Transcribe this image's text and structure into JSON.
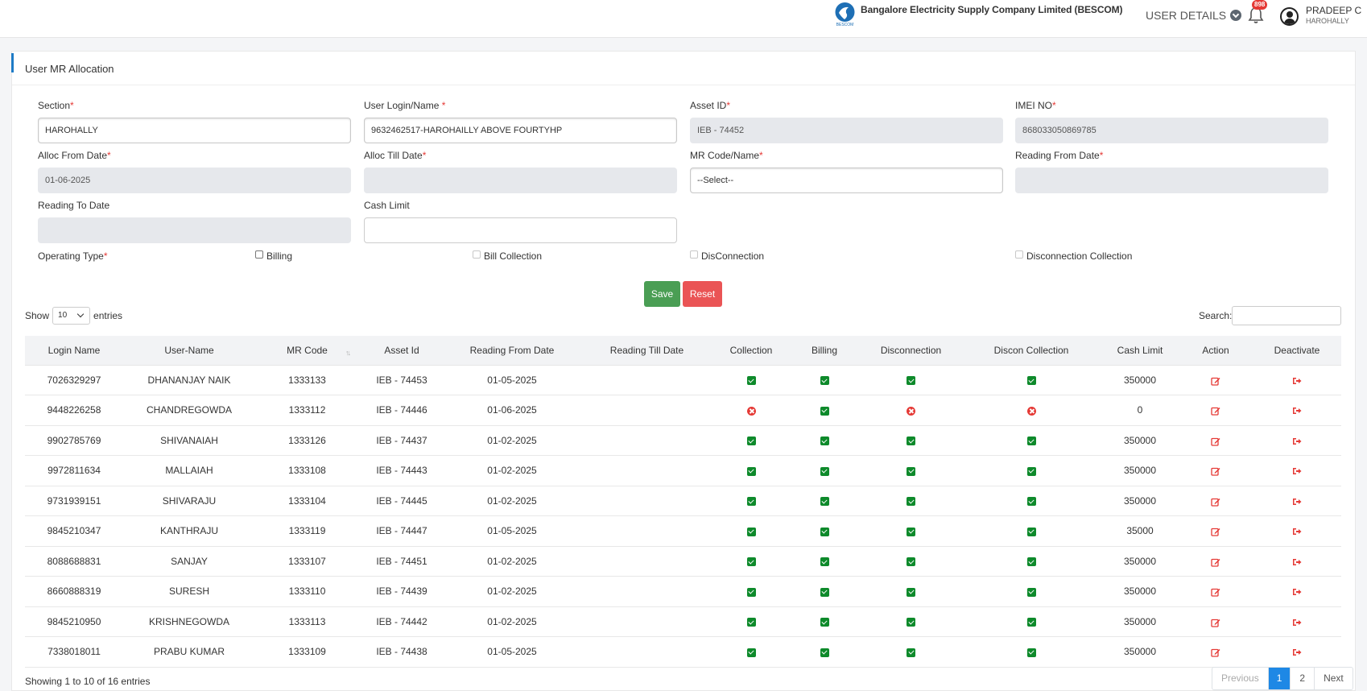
{
  "header": {
    "company": "Bangalore Electricity Supply Company Limited (BESCOM)",
    "user_details_label": "USER DETAILS",
    "notification_count": "898",
    "user_name": "PRADEEP C",
    "user_section": "HAROHALLY"
  },
  "page": {
    "title": "User MR Allocation"
  },
  "form": {
    "section_label": "Section",
    "section_value": "HAROHALLY",
    "user_login_label": "User Login/Name ",
    "user_login_value": "9632462517-HAROHAILLY ABOVE FOURTYHP",
    "asset_id_label": "Asset ID",
    "asset_id_value": "IEB - 74452",
    "imei_label": "IMEI NO",
    "imei_value": "868033050869785",
    "alloc_from_label": "Alloc From Date",
    "alloc_from_value": "01-06-2025",
    "alloc_till_label": "Alloc Till Date",
    "alloc_till_value": "",
    "mr_code_label": "MR Code/Name",
    "mr_code_value": "--Select--",
    "reading_from_label": "Reading From Date",
    "reading_from_value": "",
    "reading_to_label": "Reading To Date",
    "reading_to_value": "",
    "cash_limit_label": "Cash Limit",
    "cash_limit_value": "",
    "operating_type_label": "Operating Type",
    "op_billing": "Billing",
    "op_bill_collection": "Bill Collection",
    "op_disconnection": "DisConnection",
    "op_disconnection_collection": "Disconnection Collection",
    "required_mark": "*",
    "save_label": "Save",
    "reset_label": "Reset"
  },
  "table_controls": {
    "show_label": "Show",
    "page_length": "10",
    "entries_label": "entries",
    "search_label": "Search:"
  },
  "table": {
    "columns": [
      "Login Name",
      "User-Name",
      "MR Code",
      "Asset Id",
      "Reading From Date",
      "Reading Till Date",
      "Collection",
      "Billing",
      "Disconnection",
      "Discon Collection",
      "Cash Limit",
      "Action",
      "Deactivate"
    ],
    "rows": [
      {
        "login": "7026329297",
        "user": "DHANANJAY NAIK",
        "mr": "1333133",
        "asset": "IEB - 74453",
        "from": "01-05-2025",
        "till": "",
        "collection": true,
        "billing": true,
        "disconnection": true,
        "discon_collection": true,
        "cash": "350000"
      },
      {
        "login": "9448226258",
        "user": "CHANDREGOWDA",
        "mr": "1333112",
        "asset": "IEB - 74446",
        "from": "01-06-2025",
        "till": "",
        "collection": false,
        "billing": true,
        "disconnection": false,
        "discon_collection": false,
        "cash": "0"
      },
      {
        "login": "9902785769",
        "user": "SHIVANAIAH",
        "mr": "1333126",
        "asset": "IEB - 74437",
        "from": "01-02-2025",
        "till": "",
        "collection": true,
        "billing": true,
        "disconnection": true,
        "discon_collection": true,
        "cash": "350000"
      },
      {
        "login": "9972811634",
        "user": "MALLAIAH",
        "mr": "1333108",
        "asset": "IEB - 74443",
        "from": "01-02-2025",
        "till": "",
        "collection": true,
        "billing": true,
        "disconnection": true,
        "discon_collection": true,
        "cash": "350000"
      },
      {
        "login": "9731939151",
        "user": "SHIVARAJU",
        "mr": "1333104",
        "asset": "IEB - 74445",
        "from": "01-02-2025",
        "till": "",
        "collection": true,
        "billing": true,
        "disconnection": true,
        "discon_collection": true,
        "cash": "350000"
      },
      {
        "login": "9845210347",
        "user": "KANTHRAJU",
        "mr": "1333119",
        "asset": "IEB - 74447",
        "from": "01-05-2025",
        "till": "",
        "collection": true,
        "billing": true,
        "disconnection": true,
        "discon_collection": true,
        "cash": "35000"
      },
      {
        "login": "8088688831",
        "user": "SANJAY",
        "mr": "1333107",
        "asset": "IEB - 74451",
        "from": "01-02-2025",
        "till": "",
        "collection": true,
        "billing": true,
        "disconnection": true,
        "discon_collection": true,
        "cash": "350000"
      },
      {
        "login": "8660888319",
        "user": "SURESH",
        "mr": "1333110",
        "asset": "IEB - 74439",
        "from": "01-02-2025",
        "till": "",
        "collection": true,
        "billing": true,
        "disconnection": true,
        "discon_collection": true,
        "cash": "350000"
      },
      {
        "login": "9845210950",
        "user": "KRISHNEGOWDA",
        "mr": "1333113",
        "asset": "IEB - 74442",
        "from": "01-02-2025",
        "till": "",
        "collection": true,
        "billing": true,
        "disconnection": true,
        "discon_collection": true,
        "cash": "350000"
      },
      {
        "login": "7338018011",
        "user": "PRABU KUMAR",
        "mr": "1333109",
        "asset": "IEB - 74438",
        "from": "01-05-2025",
        "till": "",
        "collection": true,
        "billing": true,
        "disconnection": true,
        "discon_collection": true,
        "cash": "350000"
      }
    ]
  },
  "footer": {
    "info": "Showing 1 to 10 of 16 entries",
    "previous": "Previous",
    "pages": [
      "1",
      "2"
    ],
    "next": "Next"
  },
  "colors": {
    "primary": "#1e88e5",
    "success": "#4a9e54",
    "danger": "#ea5455",
    "check_green": "#0e8a2b",
    "icon_red": "#e53935"
  },
  "icons": {
    "collection_yes": "check-square-icon",
    "collection_no": "times-circle-icon",
    "action": "edit-icon",
    "deactivate": "sign-out-icon"
  }
}
